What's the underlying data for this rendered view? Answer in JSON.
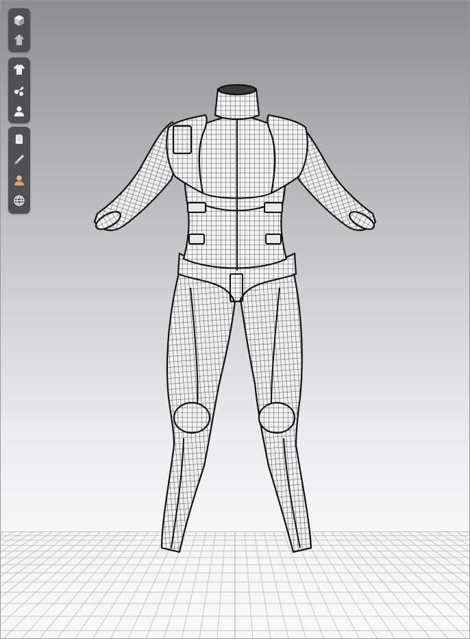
{
  "toolbar_groups": [
    {
      "name": "display",
      "tools": [
        {
          "icon": "cube-icon"
        },
        {
          "icon": "garment-avatar-icon"
        }
      ]
    },
    {
      "name": "visibility",
      "tools": [
        {
          "icon": "shirt-icon"
        },
        {
          "icon": "pins-icon"
        },
        {
          "icon": "avatar-icon"
        }
      ]
    },
    {
      "name": "render",
      "tools": [
        {
          "icon": "fabric-icon"
        },
        {
          "icon": "brush-icon"
        },
        {
          "icon": "skin-avatar-icon"
        },
        {
          "icon": "globe-icon"
        }
      ]
    }
  ],
  "colors": {
    "toolbar_bg": "#505052",
    "icon_fill": "#f2f2f2",
    "skin_tone": "#e8b68a",
    "wireframe": "#1a1a1a",
    "grid_line": "#c4c4c6"
  }
}
